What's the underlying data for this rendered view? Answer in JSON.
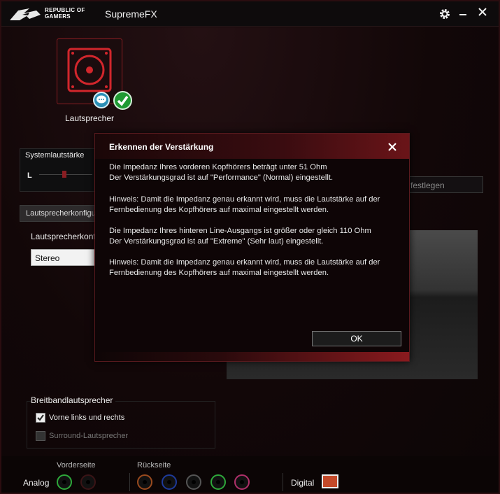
{
  "titlebar": {
    "logo_line1": "REPUBLIC OF",
    "logo_line2": "GAMERS",
    "app_name": "SupremeFX"
  },
  "device": {
    "label": "Lautsprecher"
  },
  "volume": {
    "title": "Systemlautstärke",
    "left_label": "L"
  },
  "tabs": [
    {
      "label": "Lautsprecherkonfiguration"
    }
  ],
  "config": {
    "label": "Lautsprecherkonfiguration",
    "selected": "Stereo"
  },
  "festlegen_label": "festlegen",
  "broadband": {
    "title": "Breitbandlautsprecher",
    "options": [
      {
        "label": "Vorne links und rechts",
        "checked": true,
        "enabled": true
      },
      {
        "label": "Surround-Lautsprecher",
        "checked": false,
        "enabled": false
      }
    ]
  },
  "bottom": {
    "front_label": "Vorderseite",
    "rear_label": "Rückseite",
    "analog_label": "Analog",
    "digital_label": "Digital",
    "front_jacks": [
      {
        "color": "#2ea83a"
      },
      {
        "color": "#3a1416"
      }
    ],
    "rear_jacks": [
      {
        "color": "#9a4a1e"
      },
      {
        "color": "#1e3a9a"
      },
      {
        "color": "#222222"
      },
      {
        "color": "#2ea83a"
      },
      {
        "color": "#b0306a"
      }
    ]
  },
  "dialog": {
    "title": "Erkennen der Verstärkung",
    "paragraphs": [
      "Die Impedanz Ihres vorderen Kopfhörers beträgt unter 51 Ohm\nDer Verstärkungsgrad ist auf \"Performance\" (Normal) eingestellt.",
      "Hinweis: Damit die Impedanz genau erkannt wird, muss die Lautstärke auf der Fernbedienung des Kopfhörers auf maximal eingestellt werden.",
      "Die Impedanz Ihres hinteren Line-Ausgangs ist größer oder gleich 110 Ohm\nDer Verstärkungsgrad ist auf \"Extreme\" (Sehr laut) eingestellt.",
      "Hinweis: Damit die Impedanz genau erkannt wird, muss die Lautstärke auf der Fernbedienung des Kopfhörers auf maximal eingestellt werden."
    ],
    "ok_label": "OK"
  }
}
